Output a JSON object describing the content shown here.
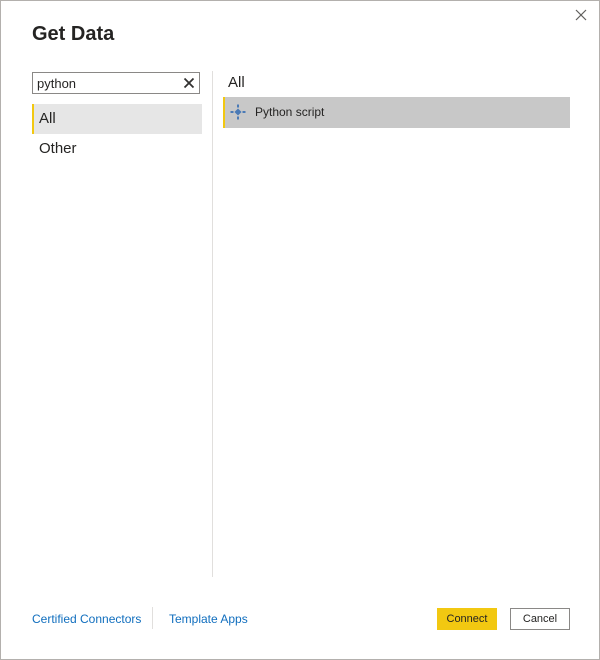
{
  "dialog": {
    "title": "Get Data"
  },
  "search": {
    "value": "python",
    "clear_icon": "close-icon"
  },
  "categories": [
    {
      "label": "All",
      "selected": true
    },
    {
      "label": "Other",
      "selected": false
    }
  ],
  "results": {
    "heading": "All",
    "items": [
      {
        "label": "Python script",
        "icon": "python-script-icon"
      }
    ]
  },
  "footer": {
    "links": [
      "Certified Connectors",
      "Template Apps"
    ],
    "connect_label": "Connect",
    "cancel_label": "Cancel"
  },
  "colors": {
    "accent": "#f2c811",
    "link": "#106ebe",
    "selected_category_bg": "#e6e6e6",
    "selected_result_bg": "#c8c8c8"
  }
}
